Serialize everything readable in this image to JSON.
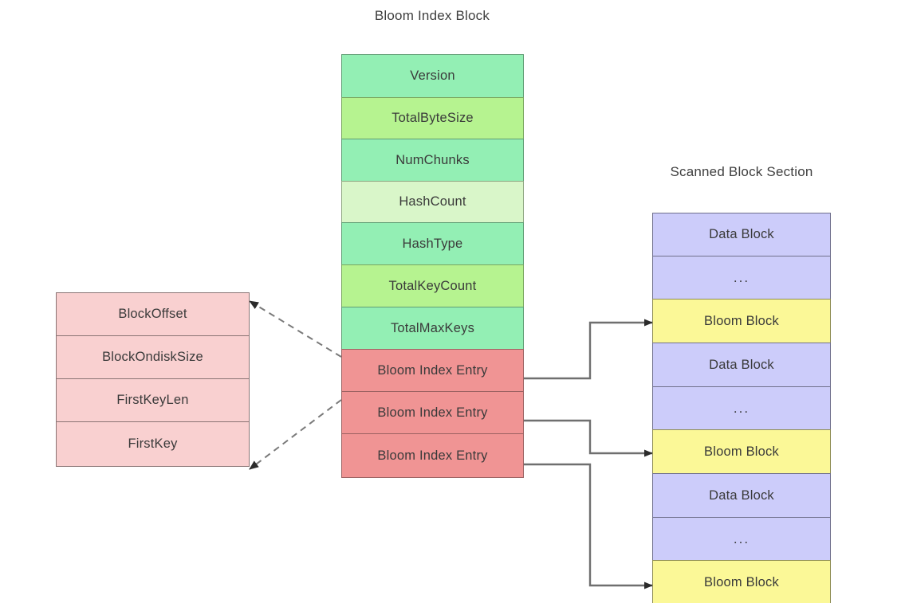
{
  "diagram": {
    "titles": {
      "bloom_index_block": "Bloom Index Block",
      "scanned_block_section": "Scanned Block Section"
    },
    "colors": {
      "green": "#93efb4",
      "green_light": "#b6f390",
      "green_pale": "#d9f6c9",
      "red": "#f09494",
      "pink": "#f9d0d0",
      "lavender": "#ccccfa",
      "yellow": "#fbf897",
      "connector": "#6f6f6f",
      "background": "#ffffff"
    },
    "bloom_index_entry_detail": {
      "rows": [
        {
          "label": "BlockOffset"
        },
        {
          "label": "BlockOndiskSize"
        },
        {
          "label": "FirstKeyLen"
        },
        {
          "label": "FirstKey"
        }
      ]
    },
    "bloom_index_block": {
      "rows": [
        {
          "label": "Version",
          "tone": "g1"
        },
        {
          "label": "TotalByteSize",
          "tone": "g2"
        },
        {
          "label": "NumChunks",
          "tone": "g1"
        },
        {
          "label": "HashCount",
          "tone": "g3"
        },
        {
          "label": "HashType",
          "tone": "g1"
        },
        {
          "label": "TotalKeyCount",
          "tone": "g2"
        },
        {
          "label": "TotalMaxKeys",
          "tone": "g1"
        },
        {
          "label": "Bloom Index Entry",
          "tone": "rd"
        },
        {
          "label": "Bloom Index Entry",
          "tone": "rd"
        },
        {
          "label": "Bloom Index Entry",
          "tone": "rd"
        }
      ]
    },
    "scanned_block_section": {
      "rows": [
        {
          "label": "Data Block",
          "tone": "bl"
        },
        {
          "label": "...",
          "tone": "bl"
        },
        {
          "label": "Bloom Block",
          "tone": "yl"
        },
        {
          "label": "Data Block",
          "tone": "bl"
        },
        {
          "label": "...",
          "tone": "bl"
        },
        {
          "label": "Bloom Block",
          "tone": "yl"
        },
        {
          "label": "Data Block",
          "tone": "bl"
        },
        {
          "label": "...",
          "tone": "bl"
        },
        {
          "label": "Bloom Block",
          "tone": "yl"
        }
      ]
    }
  }
}
